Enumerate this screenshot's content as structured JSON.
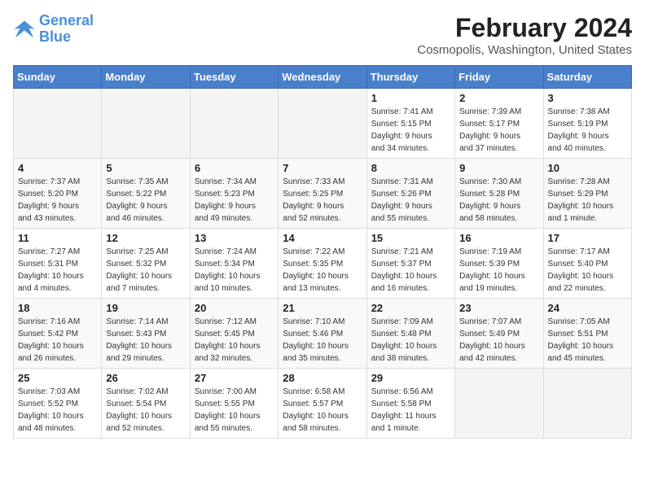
{
  "header": {
    "logo_line1": "General",
    "logo_line2": "Blue",
    "month": "February 2024",
    "location": "Cosmopolis, Washington, United States"
  },
  "weekdays": [
    "Sunday",
    "Monday",
    "Tuesday",
    "Wednesday",
    "Thursday",
    "Friday",
    "Saturday"
  ],
  "weeks": [
    [
      {
        "day": "",
        "info": ""
      },
      {
        "day": "",
        "info": ""
      },
      {
        "day": "",
        "info": ""
      },
      {
        "day": "",
        "info": ""
      },
      {
        "day": "1",
        "info": "Sunrise: 7:41 AM\nSunset: 5:15 PM\nDaylight: 9 hours\nand 34 minutes."
      },
      {
        "day": "2",
        "info": "Sunrise: 7:39 AM\nSunset: 5:17 PM\nDaylight: 9 hours\nand 37 minutes."
      },
      {
        "day": "3",
        "info": "Sunrise: 7:38 AM\nSunset: 5:19 PM\nDaylight: 9 hours\nand 40 minutes."
      }
    ],
    [
      {
        "day": "4",
        "info": "Sunrise: 7:37 AM\nSunset: 5:20 PM\nDaylight: 9 hours\nand 43 minutes."
      },
      {
        "day": "5",
        "info": "Sunrise: 7:35 AM\nSunset: 5:22 PM\nDaylight: 9 hours\nand 46 minutes."
      },
      {
        "day": "6",
        "info": "Sunrise: 7:34 AM\nSunset: 5:23 PM\nDaylight: 9 hours\nand 49 minutes."
      },
      {
        "day": "7",
        "info": "Sunrise: 7:33 AM\nSunset: 5:25 PM\nDaylight: 9 hours\nand 52 minutes."
      },
      {
        "day": "8",
        "info": "Sunrise: 7:31 AM\nSunset: 5:26 PM\nDaylight: 9 hours\nand 55 minutes."
      },
      {
        "day": "9",
        "info": "Sunrise: 7:30 AM\nSunset: 5:28 PM\nDaylight: 9 hours\nand 58 minutes."
      },
      {
        "day": "10",
        "info": "Sunrise: 7:28 AM\nSunset: 5:29 PM\nDaylight: 10 hours\nand 1 minute."
      }
    ],
    [
      {
        "day": "11",
        "info": "Sunrise: 7:27 AM\nSunset: 5:31 PM\nDaylight: 10 hours\nand 4 minutes."
      },
      {
        "day": "12",
        "info": "Sunrise: 7:25 AM\nSunset: 5:32 PM\nDaylight: 10 hours\nand 7 minutes."
      },
      {
        "day": "13",
        "info": "Sunrise: 7:24 AM\nSunset: 5:34 PM\nDaylight: 10 hours\nand 10 minutes."
      },
      {
        "day": "14",
        "info": "Sunrise: 7:22 AM\nSunset: 5:35 PM\nDaylight: 10 hours\nand 13 minutes."
      },
      {
        "day": "15",
        "info": "Sunrise: 7:21 AM\nSunset: 5:37 PM\nDaylight: 10 hours\nand 16 minutes."
      },
      {
        "day": "16",
        "info": "Sunrise: 7:19 AM\nSunset: 5:39 PM\nDaylight: 10 hours\nand 19 minutes."
      },
      {
        "day": "17",
        "info": "Sunrise: 7:17 AM\nSunset: 5:40 PM\nDaylight: 10 hours\nand 22 minutes."
      }
    ],
    [
      {
        "day": "18",
        "info": "Sunrise: 7:16 AM\nSunset: 5:42 PM\nDaylight: 10 hours\nand 26 minutes."
      },
      {
        "day": "19",
        "info": "Sunrise: 7:14 AM\nSunset: 5:43 PM\nDaylight: 10 hours\nand 29 minutes."
      },
      {
        "day": "20",
        "info": "Sunrise: 7:12 AM\nSunset: 5:45 PM\nDaylight: 10 hours\nand 32 minutes."
      },
      {
        "day": "21",
        "info": "Sunrise: 7:10 AM\nSunset: 5:46 PM\nDaylight: 10 hours\nand 35 minutes."
      },
      {
        "day": "22",
        "info": "Sunrise: 7:09 AM\nSunset: 5:48 PM\nDaylight: 10 hours\nand 38 minutes."
      },
      {
        "day": "23",
        "info": "Sunrise: 7:07 AM\nSunset: 5:49 PM\nDaylight: 10 hours\nand 42 minutes."
      },
      {
        "day": "24",
        "info": "Sunrise: 7:05 AM\nSunset: 5:51 PM\nDaylight: 10 hours\nand 45 minutes."
      }
    ],
    [
      {
        "day": "25",
        "info": "Sunrise: 7:03 AM\nSunset: 5:52 PM\nDaylight: 10 hours\nand 48 minutes."
      },
      {
        "day": "26",
        "info": "Sunrise: 7:02 AM\nSunset: 5:54 PM\nDaylight: 10 hours\nand 52 minutes."
      },
      {
        "day": "27",
        "info": "Sunrise: 7:00 AM\nSunset: 5:55 PM\nDaylight: 10 hours\nand 55 minutes."
      },
      {
        "day": "28",
        "info": "Sunrise: 6:58 AM\nSunset: 5:57 PM\nDaylight: 10 hours\nand 58 minutes."
      },
      {
        "day": "29",
        "info": "Sunrise: 6:56 AM\nSunset: 5:58 PM\nDaylight: 11 hours\nand 1 minute."
      },
      {
        "day": "",
        "info": ""
      },
      {
        "day": "",
        "info": ""
      }
    ]
  ]
}
